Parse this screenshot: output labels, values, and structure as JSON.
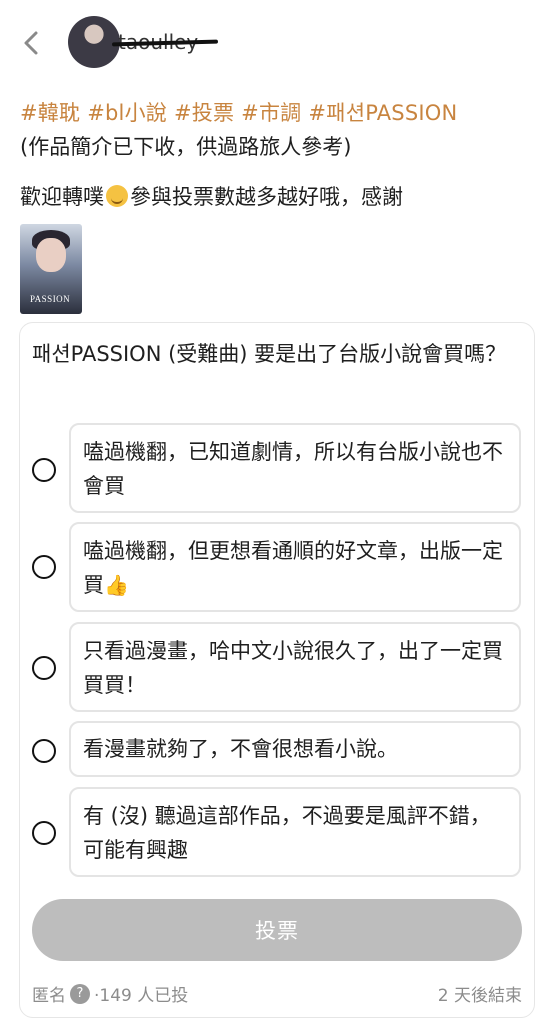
{
  "header": {
    "back_icon": "chevron-left-icon",
    "username": "taoulley",
    "avatar_icon": "avatar"
  },
  "post": {
    "tags": [
      "#韓耽",
      "#bl小說",
      "#投票",
      "#市調",
      "#패션PASSION"
    ],
    "line1": "(作品簡介已下收，供過路旅人參考)",
    "line2_before": "歡迎轉噗",
    "line2_after": "參與投票數越多越好哦，感謝",
    "wink_emoji": "wink-emoji",
    "thumbnail_title": "PASSION"
  },
  "poll": {
    "question": "패션PASSION (受難曲) 要是出了台版小說會買嗎？",
    "options": [
      {
        "label": "嗑過機翻，已知道劇情，所以有台版小說也不會買"
      },
      {
        "label": "嗑過機翻，但更想看通順的好文章，出版一定買"
      },
      {
        "label": "只看過漫畫，哈中文小說很久了，出了一定買買買！"
      },
      {
        "label": "看漫畫就夠了，不會很想看小說。"
      },
      {
        "label": "有 (沒) 聽過這部作品，不過要是風評不錯，可能有興趣"
      }
    ],
    "vote_button": "投票",
    "anonymous_label": "匿名",
    "help_symbol": "?",
    "voters": "·149 人已投",
    "ends": "2 天後結束"
  }
}
